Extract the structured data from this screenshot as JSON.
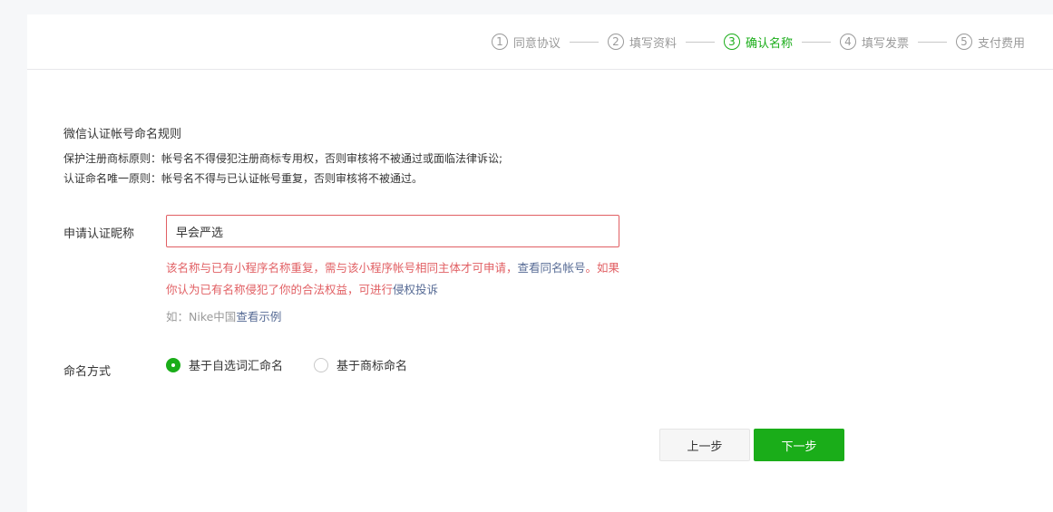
{
  "steps": [
    {
      "num": "1",
      "label": "同意协议",
      "active": false
    },
    {
      "num": "2",
      "label": "填写资料",
      "active": false
    },
    {
      "num": "3",
      "label": "确认名称",
      "active": true
    },
    {
      "num": "4",
      "label": "填写发票",
      "active": false
    },
    {
      "num": "5",
      "label": "支付费用",
      "active": false
    }
  ],
  "rules": {
    "title": "微信认证帐号命名规则",
    "line1": "保护注册商标原则：帐号名不得侵犯注册商标专用权，否则审核将不被通过或面临法律诉讼;",
    "line2": "认证命名唯一原则：帐号名不得与已认证帐号重复，否则审核将不被通过。"
  },
  "form": {
    "nickname_label": "申请认证昵称",
    "nickname_value": "早会严选",
    "error_part1": "该名称与已有小程序名称重复，需与该小程序帐号相同主体才可申请，",
    "error_link1": "查看同名帐号",
    "error_part2": "。如果你认为已有名称侵犯了你的合法权益，可进行",
    "error_link2": "侵权投诉",
    "example_prefix": "如：Nike中国",
    "example_link": "查看示例",
    "method_label": "命名方式",
    "option1": "基于自选词汇命名",
    "option2": "基于商标命名",
    "selected_option": "基于自选词汇命名"
  },
  "buttons": {
    "prev": "上一步",
    "next": "下一步"
  },
  "colors": {
    "accent": "#1aad19",
    "error": "#e15f63",
    "link": "#576b95"
  }
}
